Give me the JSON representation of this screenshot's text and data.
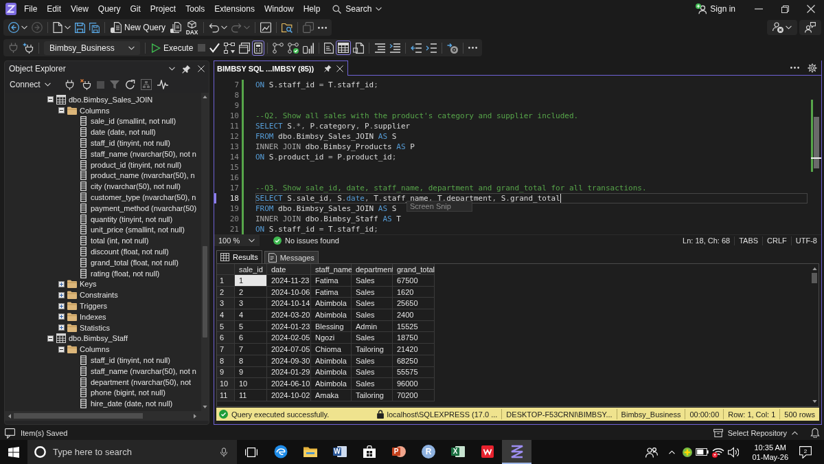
{
  "title_bar": {
    "menu": [
      "File",
      "Edit",
      "View",
      "Query",
      "Git",
      "Project",
      "Tools",
      "Extensions",
      "Window",
      "Help"
    ],
    "search": "Search",
    "sign_in": "Sign in"
  },
  "standard_toolbar": {
    "groups": [
      [
        {
          "kind": "icon",
          "disabled": false
        },
        {
          "kind": "caret",
          "disabled": false
        },
        {
          "kind": "icon",
          "disabled": true
        }
      ],
      [
        {
          "kind": "icon",
          "disabled": false
        },
        {
          "kind": "caret",
          "disabled": false
        },
        {
          "kind": "icon",
          "disabled": false
        },
        {
          "kind": "icon",
          "disabled": false
        }
      ],
      [
        {
          "kind": "button",
          "label": "New Query"
        },
        {
          "kind": "icon",
          "disabled": false
        },
        {
          "kind": "icon",
          "disabled": false,
          "glyph": "DAX"
        }
      ],
      [
        {
          "kind": "icon",
          "disabled": false
        },
        {
          "kind": "caret",
          "disabled": false
        },
        {
          "kind": "icon",
          "disabled": true
        },
        {
          "kind": "caret",
          "disabled": true
        }
      ],
      [
        {
          "kind": "icon",
          "disabled": false
        }
      ],
      [
        {
          "kind": "icon",
          "disabled": false
        }
      ],
      [
        {
          "kind": "icon",
          "disabled": true
        },
        {
          "kind": "icon",
          "disabled": false
        }
      ]
    ]
  },
  "account_toolbar": {
    "groups": [
      [
        {
          "kind": "icon"
        },
        {
          "kind": "caret"
        }
      ],
      [
        {
          "kind": "icon"
        }
      ]
    ]
  },
  "sql_toolbar": {
    "groups": [
      [
        {
          "kind": "icon",
          "disabled": true
        },
        {
          "kind": "icon",
          "disabled": false
        }
      ],
      [
        {
          "kind": "dropdown",
          "label": "Bimbsy_Business"
        }
      ],
      [
        {
          "kind": "button",
          "label": "Execute"
        },
        {
          "kind": "icon",
          "disabled": true
        },
        {
          "kind": "icon",
          "disabled": false
        },
        {
          "kind": "icon",
          "disabled": false
        },
        {
          "kind": "toggle",
          "on": false
        },
        {
          "kind": "toggle",
          "on": true
        }
      ],
      [
        {
          "kind": "icon",
          "disabled": false
        },
        {
          "kind": "toggle",
          "on": false
        },
        {
          "kind": "toggle",
          "on": false
        }
      ],
      [
        {
          "kind": "toggle",
          "on": false
        },
        {
          "kind": "toggle",
          "on": true
        },
        {
          "kind": "toggle",
          "on": false
        }
      ],
      [
        {
          "kind": "icon",
          "disabled": false
        },
        {
          "kind": "icon",
          "disabled": false
        }
      ],
      [
        {
          "kind": "icon",
          "disabled": false
        },
        {
          "kind": "icon",
          "disabled": false
        }
      ],
      [
        {
          "kind": "icon",
          "disabled": false
        }
      ],
      [
        {
          "kind": "icon",
          "disabled": false
        }
      ]
    ]
  },
  "object_explorer": {
    "title": "Object Explorer",
    "connect": "Connect",
    "tools": [
      {
        "disabled": false
      },
      {
        "disabled": false
      },
      {
        "disabled": true
      },
      {
        "disabled": true
      },
      {
        "disabled": false
      },
      {
        "disabled": true
      },
      {
        "disabled": false
      }
    ],
    "tree": [
      {
        "kind": "table",
        "label": "dbo.Bimbsy_Sales_JOIN",
        "expanded": true,
        "children": [
          {
            "kind": "folder",
            "label": "Columns",
            "expanded": true,
            "children": [
              {
                "kind": "column",
                "label": "sale_id (smallint, not null)"
              },
              {
                "kind": "column",
                "label": "date (date, not null)"
              },
              {
                "kind": "column",
                "label": "staff_id (tinyint, not null)"
              },
              {
                "kind": "column",
                "label": "staff_name (nvarchar(50), not n"
              },
              {
                "kind": "column",
                "label": "product_id (tinyint, not null)"
              },
              {
                "kind": "column",
                "label": "product_name (nvarchar(50), n"
              },
              {
                "kind": "column",
                "label": "city (nvarchar(50), not null)"
              },
              {
                "kind": "column",
                "label": "customer_type (nvarchar(50), n"
              },
              {
                "kind": "column",
                "label": "payment_method (nvarchar(50)"
              },
              {
                "kind": "column",
                "label": "quantity (tinyint, not null)"
              },
              {
                "kind": "column",
                "label": "unit_price (smallint, not null)"
              },
              {
                "kind": "column",
                "label": "total (int, not null)"
              },
              {
                "kind": "column",
                "label": "discount (float, not null)"
              },
              {
                "kind": "column",
                "label": "grand_total (float, not null)"
              },
              {
                "kind": "column",
                "label": "rating (float, not null)"
              }
            ]
          },
          {
            "kind": "folder",
            "label": "Keys",
            "expanded": false
          },
          {
            "kind": "folder",
            "label": "Constraints",
            "expanded": false
          },
          {
            "kind": "folder",
            "label": "Triggers",
            "expanded": false
          },
          {
            "kind": "folder",
            "label": "Indexes",
            "expanded": false
          },
          {
            "kind": "folder",
            "label": "Statistics",
            "expanded": false
          }
        ]
      },
      {
        "kind": "table",
        "label": "dbo.Bimbsy_Staff",
        "expanded": true,
        "children": [
          {
            "kind": "folder",
            "label": "Columns",
            "expanded": true,
            "children": [
              {
                "kind": "column",
                "label": "staff_id (tinyint, not null)"
              },
              {
                "kind": "column",
                "label": "staff_name (nvarchar(50), not n"
              },
              {
                "kind": "column",
                "label": "department (nvarchar(50), not"
              },
              {
                "kind": "column",
                "label": "phone (bigint, not null)"
              },
              {
                "kind": "column",
                "label": "hire_date (date, not null)"
              }
            ]
          }
        ]
      }
    ]
  },
  "editor": {
    "tab": {
      "label": "BIMBSY SQL ...IMBSY (85))",
      "selected": true
    },
    "lines": [
      {
        "number": "7",
        "changed": true,
        "current": false,
        "tokens": [
          {
            "kind": "keyword",
            "text": "ON"
          },
          {
            "kind": "identifier",
            "text": " S"
          },
          {
            "kind": "operator",
            "text": "."
          },
          {
            "kind": "identifier",
            "text": "staff_id "
          },
          {
            "kind": "operator",
            "text": "="
          },
          {
            "kind": "identifier",
            "text": " T"
          },
          {
            "kind": "operator",
            "text": "."
          },
          {
            "kind": "identifier",
            "text": "staff_id"
          },
          {
            "kind": "operator",
            "text": ";"
          }
        ]
      },
      {
        "number": "8",
        "changed": true,
        "current": false
      },
      {
        "number": "9",
        "changed": true,
        "current": false
      },
      {
        "number": "10",
        "changed": true,
        "current": false,
        "tokens": [
          {
            "kind": "comment",
            "text": "--Q2. Show all sales with the product's category and supplier included."
          }
        ]
      },
      {
        "number": "11",
        "changed": true,
        "current": false,
        "tokens": [
          {
            "kind": "keyword",
            "text": "SELECT"
          },
          {
            "kind": "identifier",
            "text": " S"
          },
          {
            "kind": "operator",
            "text": ".*,"
          },
          {
            "kind": "identifier",
            "text": " P"
          },
          {
            "kind": "operator",
            "text": "."
          },
          {
            "kind": "identifier",
            "text": "category"
          },
          {
            "kind": "operator",
            "text": ","
          },
          {
            "kind": "identifier",
            "text": " P"
          },
          {
            "kind": "operator",
            "text": "."
          },
          {
            "kind": "identifier",
            "text": "supplier"
          }
        ]
      },
      {
        "number": "12",
        "changed": true,
        "current": false,
        "tokens": [
          {
            "kind": "keyword",
            "text": "FROM"
          },
          {
            "kind": "identifier",
            "text": " dbo"
          },
          {
            "kind": "operator",
            "text": "."
          },
          {
            "kind": "identifier",
            "text": "Bimbsy_Sales_JOIN "
          },
          {
            "kind": "keyword",
            "text": "AS"
          },
          {
            "kind": "identifier",
            "text": " S"
          }
        ]
      },
      {
        "number": "13",
        "changed": true,
        "current": false,
        "tokens": [
          {
            "kind": "operator",
            "text": "INNER JOIN"
          },
          {
            "kind": "identifier",
            "text": " dbo"
          },
          {
            "kind": "operator",
            "text": "."
          },
          {
            "kind": "identifier",
            "text": "Bimbsy_Products "
          },
          {
            "kind": "keyword",
            "text": "AS"
          },
          {
            "kind": "identifier",
            "text": " P"
          }
        ]
      },
      {
        "number": "14",
        "changed": true,
        "current": false,
        "tokens": [
          {
            "kind": "keyword",
            "text": "ON"
          },
          {
            "kind": "identifier",
            "text": " S"
          },
          {
            "kind": "operator",
            "text": "."
          },
          {
            "kind": "identifier",
            "text": "product_id "
          },
          {
            "kind": "operator",
            "text": "="
          },
          {
            "kind": "identifier",
            "text": " P"
          },
          {
            "kind": "operator",
            "text": "."
          },
          {
            "kind": "identifier",
            "text": "product_id"
          },
          {
            "kind": "operator",
            "text": ";"
          }
        ]
      },
      {
        "number": "15",
        "changed": true,
        "current": false
      },
      {
        "number": "16",
        "changed": true,
        "current": false
      },
      {
        "number": "17",
        "changed": true,
        "current": false,
        "tokens": [
          {
            "kind": "comment",
            "text": "--Q3. Show sale_id, date, staff_name, department and grand_total for all transactions."
          }
        ]
      },
      {
        "number": "18",
        "changed": true,
        "current": true,
        "tokens": [
          {
            "kind": "keyword",
            "text": "SELECT"
          },
          {
            "kind": "identifier",
            "text": " S"
          },
          {
            "kind": "operator",
            "text": "."
          },
          {
            "kind": "identifier",
            "text": "sale_id"
          },
          {
            "kind": "operator",
            "text": ","
          },
          {
            "kind": "identifier",
            "text": " S"
          },
          {
            "kind": "operator",
            "text": "."
          },
          {
            "kind": "keyword",
            "text": "date"
          },
          {
            "kind": "operator",
            "text": ","
          },
          {
            "kind": "identifier",
            "text": " T"
          },
          {
            "kind": "operator",
            "text": "."
          },
          {
            "kind": "identifier",
            "text": "staff_name"
          },
          {
            "kind": "operator",
            "text": ","
          },
          {
            "kind": "identifier",
            "text": " T"
          },
          {
            "kind": "operator",
            "text": "."
          },
          {
            "kind": "identifier",
            "text": "department"
          },
          {
            "kind": "operator",
            "text": ","
          },
          {
            "kind": "identifier",
            "text": " S"
          },
          {
            "kind": "operator",
            "text": "."
          },
          {
            "kind": "identifier",
            "text": "grand_total"
          }
        ]
      },
      {
        "number": "19",
        "changed": true,
        "current": false,
        "tokens": [
          {
            "kind": "keyword",
            "text": "FROM"
          },
          {
            "kind": "identifier",
            "text": " dbo"
          },
          {
            "kind": "operator",
            "text": "."
          },
          {
            "kind": "identifier",
            "text": "Bimbsy_Sales_JOIN "
          },
          {
            "kind": "keyword",
            "text": "AS"
          },
          {
            "kind": "identifier",
            "text": " S"
          }
        ]
      },
      {
        "number": "20",
        "changed": true,
        "current": false,
        "tokens": [
          {
            "kind": "operator",
            "text": "INNER JOIN"
          },
          {
            "kind": "identifier",
            "text": " dbo"
          },
          {
            "kind": "operator",
            "text": "."
          },
          {
            "kind": "identifier",
            "text": "Bimbsy_Staff "
          },
          {
            "kind": "keyword",
            "text": "AS"
          },
          {
            "kind": "identifier",
            "text": " T"
          }
        ]
      },
      {
        "number": "21",
        "changed": true,
        "current": false,
        "tokens": [
          {
            "kind": "keyword",
            "text": "ON"
          },
          {
            "kind": "identifier",
            "text": " S"
          },
          {
            "kind": "operator",
            "text": "."
          },
          {
            "kind": "identifier",
            "text": "staff_id "
          },
          {
            "kind": "operator",
            "text": "="
          },
          {
            "kind": "identifier",
            "text": " T"
          },
          {
            "kind": "operator",
            "text": "."
          },
          {
            "kind": "identifier",
            "text": "staff_id"
          },
          {
            "kind": "operator",
            "text": ";"
          }
        ]
      }
    ],
    "tooltip": "Screen Snip",
    "status": {
      "zoom": "100 %",
      "issues": "No issues found",
      "position": "Ln: 18, Ch: 68",
      "indent": "TABS",
      "line_ending": "CRLF",
      "encoding": "UTF-8"
    }
  },
  "results": {
    "tabs": [
      {
        "label": "Results",
        "selected": true
      },
      {
        "label": "Messages",
        "selected": false
      }
    ],
    "columns": [
      "sale_id",
      "date",
      "staff_name",
      "department",
      "grand_total"
    ],
    "rows": [
      {
        "number": "1",
        "cells": [
          {
            "text": "1",
            "selected": true
          },
          {
            "text": "2024-11-23",
            "selected": false
          },
          {
            "text": "Fatima",
            "selected": false
          },
          {
            "text": "Sales",
            "selected": false
          },
          {
            "text": "67500",
            "selected": false
          }
        ]
      },
      {
        "number": "2",
        "cells": [
          {
            "text": "2",
            "selected": false
          },
          {
            "text": "2024-10-06",
            "selected": false
          },
          {
            "text": "Fatima",
            "selected": false
          },
          {
            "text": "Sales",
            "selected": false
          },
          {
            "text": "1620",
            "selected": false
          }
        ]
      },
      {
        "number": "3",
        "cells": [
          {
            "text": "3",
            "selected": false
          },
          {
            "text": "2024-10-14",
            "selected": false
          },
          {
            "text": "Abimbola",
            "selected": false
          },
          {
            "text": "Sales",
            "selected": false
          },
          {
            "text": "25650",
            "selected": false
          }
        ]
      },
      {
        "number": "4",
        "cells": [
          {
            "text": "4",
            "selected": false
          },
          {
            "text": "2024-03-20",
            "selected": false
          },
          {
            "text": "Abimbola",
            "selected": false
          },
          {
            "text": "Sales",
            "selected": false
          },
          {
            "text": "2400",
            "selected": false
          }
        ]
      },
      {
        "number": "5",
        "cells": [
          {
            "text": "5",
            "selected": false
          },
          {
            "text": "2024-01-23",
            "selected": false
          },
          {
            "text": "Blessing",
            "selected": false
          },
          {
            "text": "Admin",
            "selected": false
          },
          {
            "text": "15525",
            "selected": false
          }
        ]
      },
      {
        "number": "6",
        "cells": [
          {
            "text": "6",
            "selected": false
          },
          {
            "text": "2024-02-05",
            "selected": false
          },
          {
            "text": "Ngozi",
            "selected": false
          },
          {
            "text": "Sales",
            "selected": false
          },
          {
            "text": "18750",
            "selected": false
          }
        ]
      },
      {
        "number": "7",
        "cells": [
          {
            "text": "7",
            "selected": false
          },
          {
            "text": "2024-07-05",
            "selected": false
          },
          {
            "text": "Chioma",
            "selected": false
          },
          {
            "text": "Tailoring",
            "selected": false
          },
          {
            "text": "21420",
            "selected": false
          }
        ]
      },
      {
        "number": "8",
        "cells": [
          {
            "text": "8",
            "selected": false
          },
          {
            "text": "2024-09-30",
            "selected": false
          },
          {
            "text": "Abimbola",
            "selected": false
          },
          {
            "text": "Sales",
            "selected": false
          },
          {
            "text": "68250",
            "selected": false
          }
        ]
      },
      {
        "number": "9",
        "cells": [
          {
            "text": "9",
            "selected": false
          },
          {
            "text": "2024-01-29",
            "selected": false
          },
          {
            "text": "Abimbola",
            "selected": false
          },
          {
            "text": "Sales",
            "selected": false
          },
          {
            "text": "55575",
            "selected": false
          }
        ]
      },
      {
        "number": "10",
        "cells": [
          {
            "text": "10",
            "selected": false
          },
          {
            "text": "2024-06-10",
            "selected": false
          },
          {
            "text": "Abimbola",
            "selected": false
          },
          {
            "text": "Sales",
            "selected": false
          },
          {
            "text": "96000",
            "selected": false
          }
        ]
      },
      {
        "number": "11",
        "cells": [
          {
            "text": "11",
            "selected": false
          },
          {
            "text": "2024-10-02",
            "selected": false
          },
          {
            "text": "Amaka",
            "selected": false
          },
          {
            "text": "Tailoring",
            "selected": false
          },
          {
            "text": "70200",
            "selected": false
          }
        ]
      }
    ]
  },
  "query_status": {
    "message": "Query executed successfully.",
    "fields": [
      "localhost\\SQLEXPRESS (17.0 ...",
      "DESKTOP-F53CRNI\\BIMBSY...",
      "Bimbsy_Business",
      "00:00:00",
      "Row: 1, Col: 1",
      "500 rows"
    ]
  },
  "status_bar": {
    "message": "Item(s) Saved",
    "repository": "Select Repository"
  },
  "taskbar": {
    "search_placeholder": "Type here to search",
    "apps": [
      {
        "active": false
      },
      {
        "active": false
      },
      {
        "glyph": "W",
        "active": false
      },
      {
        "active": false
      },
      {
        "glyph": "P",
        "active": false
      },
      {
        "glyph": "R",
        "active": false
      },
      {
        "glyph": "X",
        "active": false
      },
      {
        "active": false
      },
      {
        "active": true
      }
    ],
    "time": "10:35 AM",
    "date": "01-May-26",
    "notifications": "2"
  }
}
